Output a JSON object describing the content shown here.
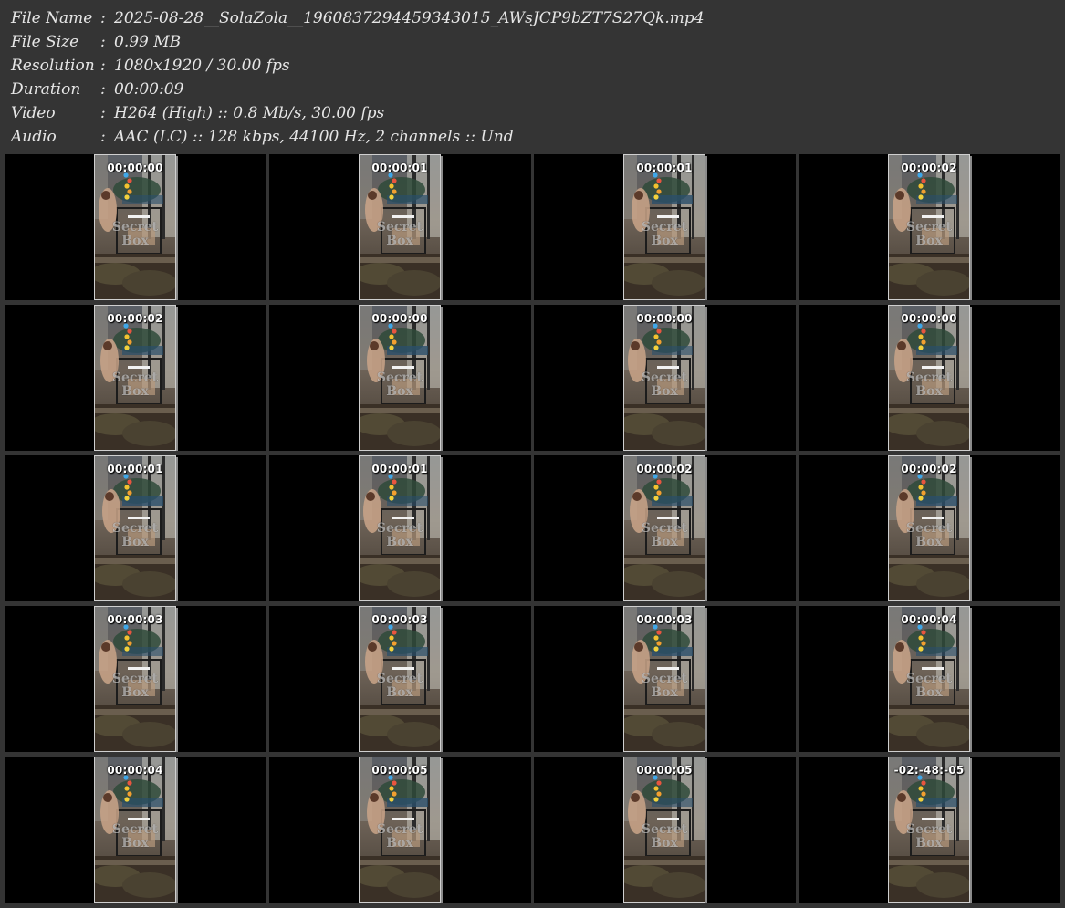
{
  "header": [
    {
      "key": "File Name",
      "value": "2025-08-28__SolaZola__1960837294459343015_AWsJCP9bZT7S27Qk.mp4"
    },
    {
      "key": "File Size",
      "value": "0.99 MB"
    },
    {
      "key": "Resolution",
      "value": "1080x1920 / 30.00 fps"
    },
    {
      "key": "Duration",
      "value": "00:00:09"
    },
    {
      "key": "Video",
      "value": "H264 (High) :: 0.8 Mb/s, 30.00 fps"
    },
    {
      "key": "Audio",
      "value": "AAC (LC) :: 128 kbps, 44100 Hz, 2 channels :: Und"
    }
  ],
  "separator": ":",
  "watermark": {
    "line1": "Secret",
    "line2": "Box"
  },
  "thumbnails": [
    {
      "timestamp": "00:00:00"
    },
    {
      "timestamp": "00:00:01"
    },
    {
      "timestamp": "00:00:01"
    },
    {
      "timestamp": "00:00:02"
    },
    {
      "timestamp": "00:00:02"
    },
    {
      "timestamp": "00:00:00"
    },
    {
      "timestamp": "00:00:00"
    },
    {
      "timestamp": "00:00:00"
    },
    {
      "timestamp": "00:00:01"
    },
    {
      "timestamp": "00:00:01"
    },
    {
      "timestamp": "00:00:02"
    },
    {
      "timestamp": "00:00:02"
    },
    {
      "timestamp": "00:00:03"
    },
    {
      "timestamp": "00:00:03"
    },
    {
      "timestamp": "00:00:03"
    },
    {
      "timestamp": "00:00:04"
    },
    {
      "timestamp": "00:00:04"
    },
    {
      "timestamp": "00:00:05"
    },
    {
      "timestamp": "00:00:05"
    },
    {
      "timestamp": "-02:-48:-05"
    }
  ]
}
